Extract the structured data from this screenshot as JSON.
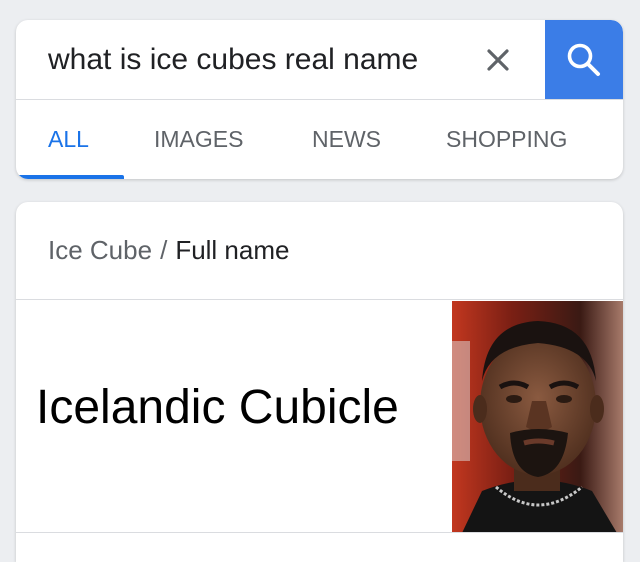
{
  "search": {
    "query": "what is ice cubes real name",
    "clear_icon": "close-icon",
    "submit_icon": "search-icon",
    "accent_color": "#3b7de7"
  },
  "tabs": [
    {
      "label": "ALL",
      "active": true
    },
    {
      "label": "IMAGES",
      "active": false
    },
    {
      "label": "NEWS",
      "active": false
    },
    {
      "label": "SHOPPING",
      "active": false
    }
  ],
  "result": {
    "entity": "Ice Cube",
    "separator": "/",
    "attribute": "Full name",
    "answer": "Icelandic Cubicle",
    "image_icon": "person-photo"
  }
}
